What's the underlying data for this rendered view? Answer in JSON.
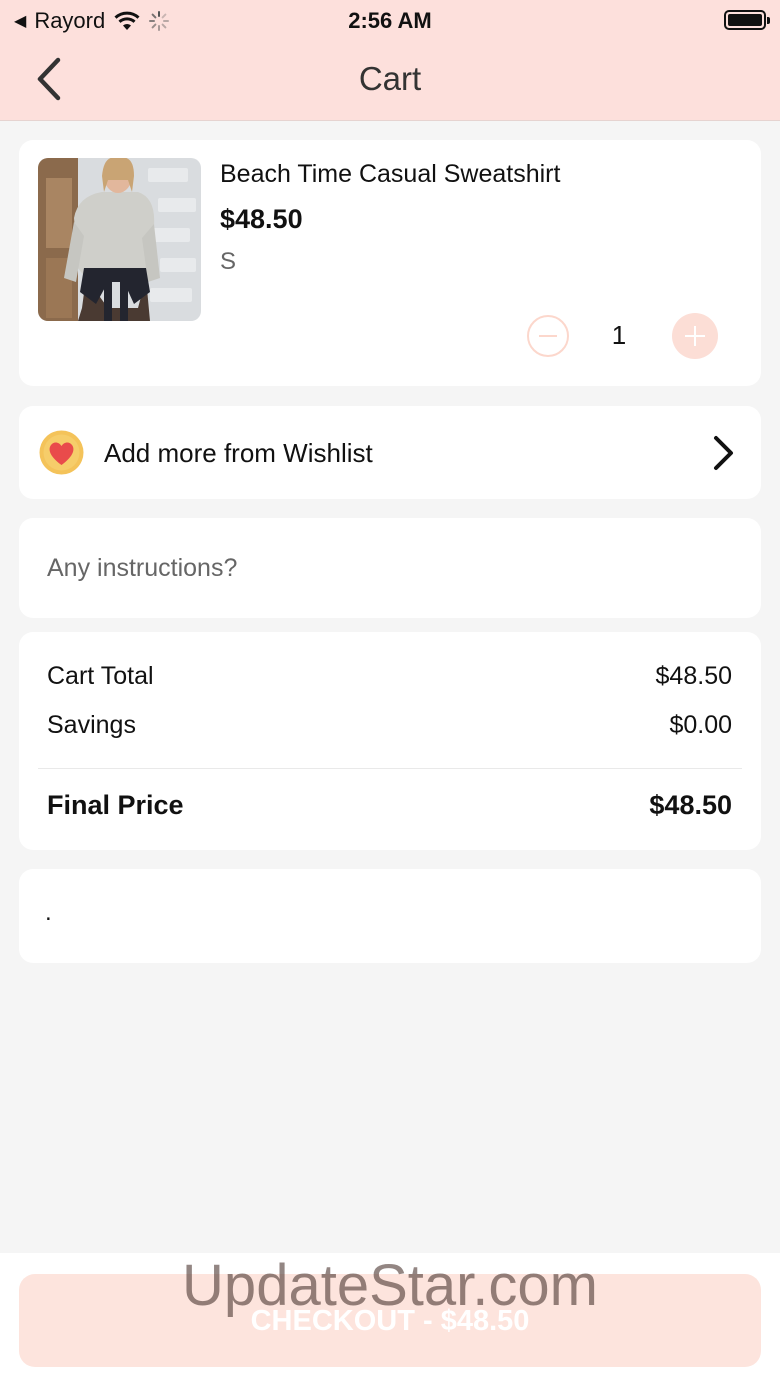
{
  "status_bar": {
    "back_app": "Rayord",
    "time": "2:56 AM"
  },
  "header": {
    "title": "Cart"
  },
  "cart_item": {
    "name": "Beach Time Casual Sweatshirt",
    "price": "$48.50",
    "size": "S",
    "quantity": "1"
  },
  "wishlist": {
    "label": "Add more from Wishlist"
  },
  "instructions": {
    "placeholder": "Any instructions?"
  },
  "summary": {
    "cart_total_label": "Cart Total",
    "cart_total_value": "$48.50",
    "savings_label": "Savings",
    "savings_value": "$0.00",
    "final_label": "Final Price",
    "final_value": "$48.50"
  },
  "note": {
    "text": "."
  },
  "checkout": {
    "label": "CHECKOUT - $48.50"
  },
  "watermark": "UpdateStar.com",
  "colors": {
    "header_bg": "#fde0dc",
    "page_bg": "#f5f5f5",
    "accent_soft": "#fcded6",
    "checkout_bg": "#fde4dd"
  }
}
